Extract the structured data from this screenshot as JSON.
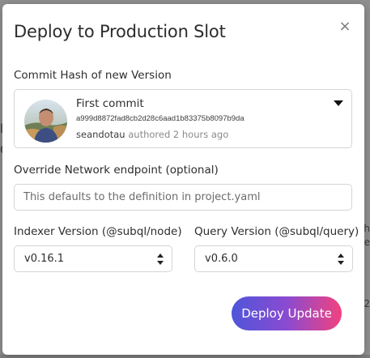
{
  "modal": {
    "title": "Deploy to Production Slot",
    "close_glyph": "×"
  },
  "commit": {
    "label": "Commit Hash of new Version",
    "title": "First commit",
    "hash": "a999d8872fad8cb2d28c6aad1b83375b8097b9da",
    "author": "seandotau",
    "when": "authored 2 hours ago"
  },
  "endpoint": {
    "label": "Override Network endpoint (optional)",
    "placeholder": "This defaults to the definition in project.yaml",
    "value": ""
  },
  "indexer": {
    "label": "Indexer Version (@subql/node)",
    "selected": "v0.16.1"
  },
  "query": {
    "label": "Query Version (@subql/query)",
    "selected": "v0.6.0"
  },
  "actions": {
    "deploy_label": "Deploy Update"
  },
  "colors": {
    "button_gradient_start": "#4f55d9",
    "button_gradient_end": "#f2427e",
    "backdrop": "#8f8f8f"
  },
  "icons": {
    "close": "close-icon",
    "commit_dropdown": "caret-down-icon",
    "select": "up-down-arrows-icon"
  }
}
